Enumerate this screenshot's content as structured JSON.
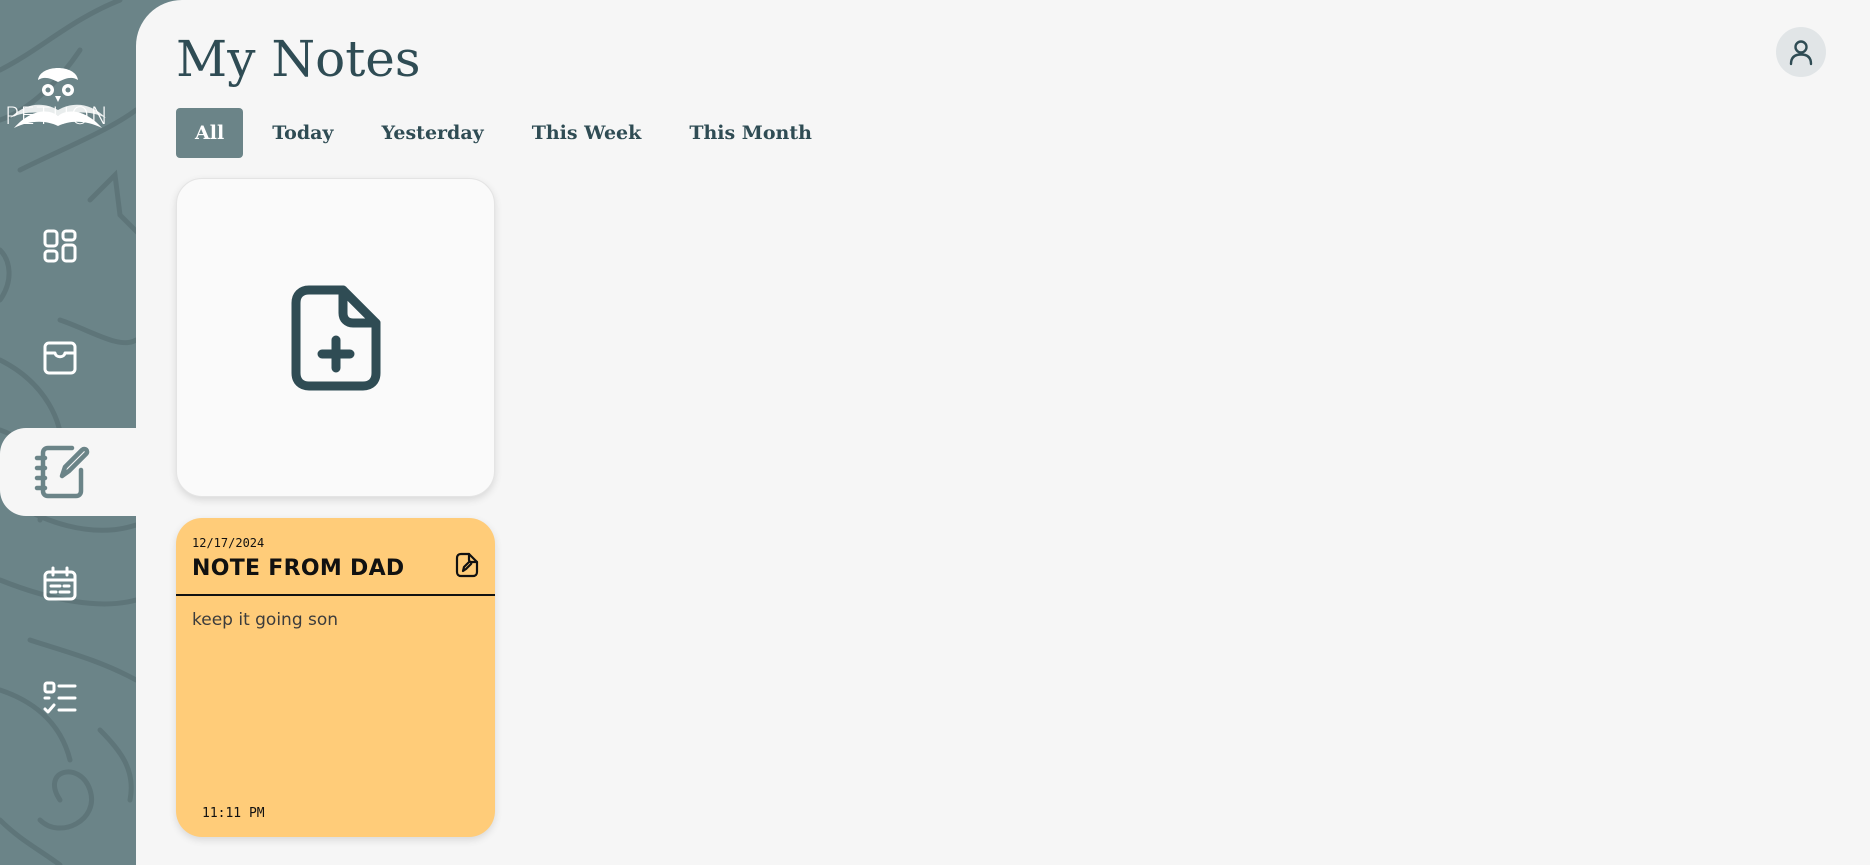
{
  "brand": {
    "name": "PETUON",
    "logo_icon": "owl-book-logo"
  },
  "sidebar": {
    "items": [
      {
        "name": "dashboard",
        "icon": "dashboard-grid-icon",
        "active": false
      },
      {
        "name": "inbox",
        "icon": "inbox-tray-icon",
        "active": false
      },
      {
        "name": "notes",
        "icon": "notebook-pen-icon",
        "active": true
      },
      {
        "name": "calendar",
        "icon": "calendar-icon",
        "active": false
      },
      {
        "name": "tasks",
        "icon": "checklist-icon",
        "active": false
      }
    ]
  },
  "header": {
    "title": "My Notes",
    "avatar_icon": "user-icon"
  },
  "filters": {
    "tabs": [
      {
        "label": "All",
        "active": true
      },
      {
        "label": "Today",
        "active": false
      },
      {
        "label": "Yesterday",
        "active": false
      },
      {
        "label": "This Week",
        "active": false
      },
      {
        "label": "This Month",
        "active": false
      }
    ]
  },
  "new_note": {
    "icon": "file-plus-icon"
  },
  "notes": [
    {
      "date": "12/17/2024",
      "title": "NOTE FROM DAD",
      "body": "keep it going son",
      "time": "11:11 PM",
      "color": "#ffcc79",
      "edit_icon": "file-edit-icon"
    }
  ],
  "colors": {
    "sidebar": "#6b8488",
    "background": "#f6f6f6",
    "text_primary": "#2f4c54",
    "note_yellow": "#ffcc79"
  }
}
